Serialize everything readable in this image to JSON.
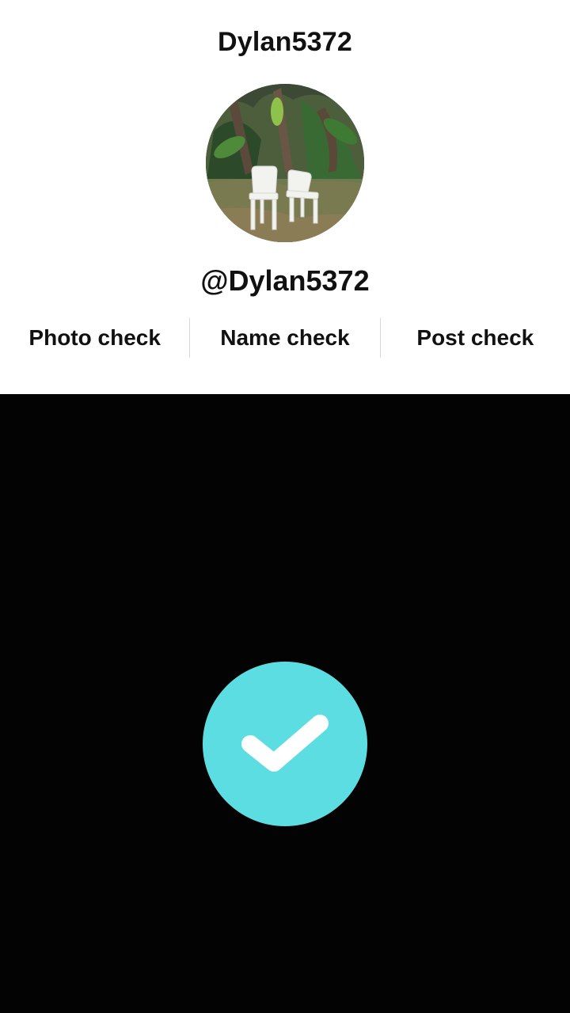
{
  "profile": {
    "display_name": "Dylan5372",
    "username": "@Dylan5372",
    "avatar_description_icon": "photo-avatar"
  },
  "checks": [
    {
      "label": "Photo check"
    },
    {
      "label": "Name check"
    },
    {
      "label": "Post check"
    }
  ],
  "status": {
    "icon": "checkmark-icon",
    "color": "#5cdde2"
  }
}
